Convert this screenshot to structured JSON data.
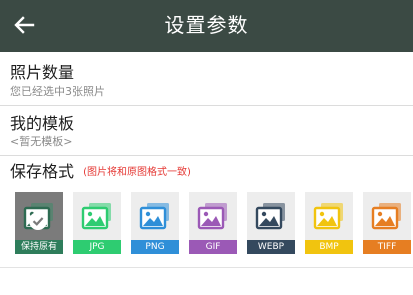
{
  "header": {
    "title": "设置参数",
    "back_icon": "arrow-left-icon"
  },
  "photo_count": {
    "title": "照片数量",
    "subtitle": "您已经选中3张照片"
  },
  "template": {
    "title": "我的模板",
    "subtitle": "<暂无模板>"
  },
  "save_format": {
    "title": "保存格式",
    "note": "(图片将和原图格式一致)",
    "selected": "保持原有",
    "options": [
      {
        "label": "保持原有",
        "color": "#2e7d5b",
        "selected": true
      },
      {
        "label": "JPG",
        "color": "#2ecc71",
        "selected": false
      },
      {
        "label": "PNG",
        "color": "#2f8fd8",
        "selected": false
      },
      {
        "label": "GIF",
        "color": "#9b59b6",
        "selected": false
      },
      {
        "label": "WEBP",
        "color": "#34495e",
        "selected": false
      },
      {
        "label": "BMP",
        "color": "#f1c40f",
        "selected": false
      },
      {
        "label": "TIFF",
        "color": "#e67e22",
        "selected": false
      }
    ]
  }
}
